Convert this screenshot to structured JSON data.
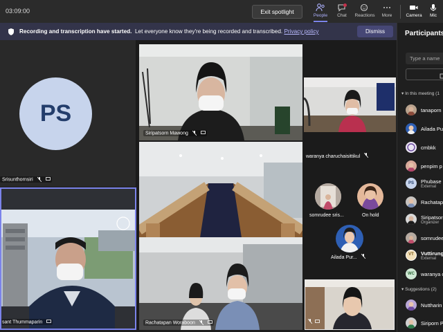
{
  "header": {
    "timer": "03:09:00",
    "exit_spotlight": "Exit spotlight",
    "toolbar": [
      {
        "label": "People",
        "icon": "people-icon",
        "active": true
      },
      {
        "label": "Chat",
        "icon": "chat-icon"
      },
      {
        "label": "Reactions",
        "icon": "reactions-icon"
      },
      {
        "label": "More",
        "icon": "more-icon"
      },
      {
        "label": "Camera",
        "icon": "camera-icon"
      },
      {
        "label": "Mic",
        "icon": "mic-icon"
      }
    ]
  },
  "banner": {
    "title": "Recording and transcription have started.",
    "message": "Let everyone know they're being recorded and transcribed.",
    "link": "Privacy policy",
    "dismiss": "Dismiss"
  },
  "tiles": {
    "ps_initials": "PS",
    "ps_name": "Srisunthornsiri",
    "spotlight_name": "sant Thummaparin",
    "siripatsorn": "Siripatsorn Mawong",
    "cmbkk": "cmbkk",
    "rachatapan": "Rachatapan Woraboon",
    "waranya": "waranya charuchaisittikul",
    "somrudee": "somrudee sris...",
    "on_hold": "On hold",
    "ailada": "Ailada Pur..."
  },
  "panel": {
    "title": "Participants",
    "search_placeholder": "Type a name",
    "in_meeting": "In this meeting (1",
    "suggestions": "Suggestions (2)",
    "people": [
      {
        "name": "tanaporn",
        "sub": ""
      },
      {
        "name": "Ailada Pu",
        "sub": ""
      },
      {
        "name": "cmbkk",
        "sub": ""
      },
      {
        "name": "penpim p",
        "sub": ""
      },
      {
        "name": "Phubase",
        "sub": "External",
        "initials": "PS"
      },
      {
        "name": "Rachatap",
        "sub": ""
      },
      {
        "name": "Siripatsor",
        "sub": "Organizer"
      },
      {
        "name": "somrudee",
        "sub": ""
      },
      {
        "name": "Vuttirung",
        "sub": "External",
        "initials": "VT"
      },
      {
        "name": "waranya c",
        "sub": "",
        "initials": "WC"
      }
    ],
    "suggested": [
      {
        "name": "Nuttharin",
        "sub": ""
      },
      {
        "name": "Siriporn P",
        "sub": ""
      }
    ]
  },
  "colors": {
    "accent": "#7b83eb",
    "banner": "#33344a",
    "ps_avatar": "#c7d4ec",
    "ps_text": "#233d6b"
  }
}
